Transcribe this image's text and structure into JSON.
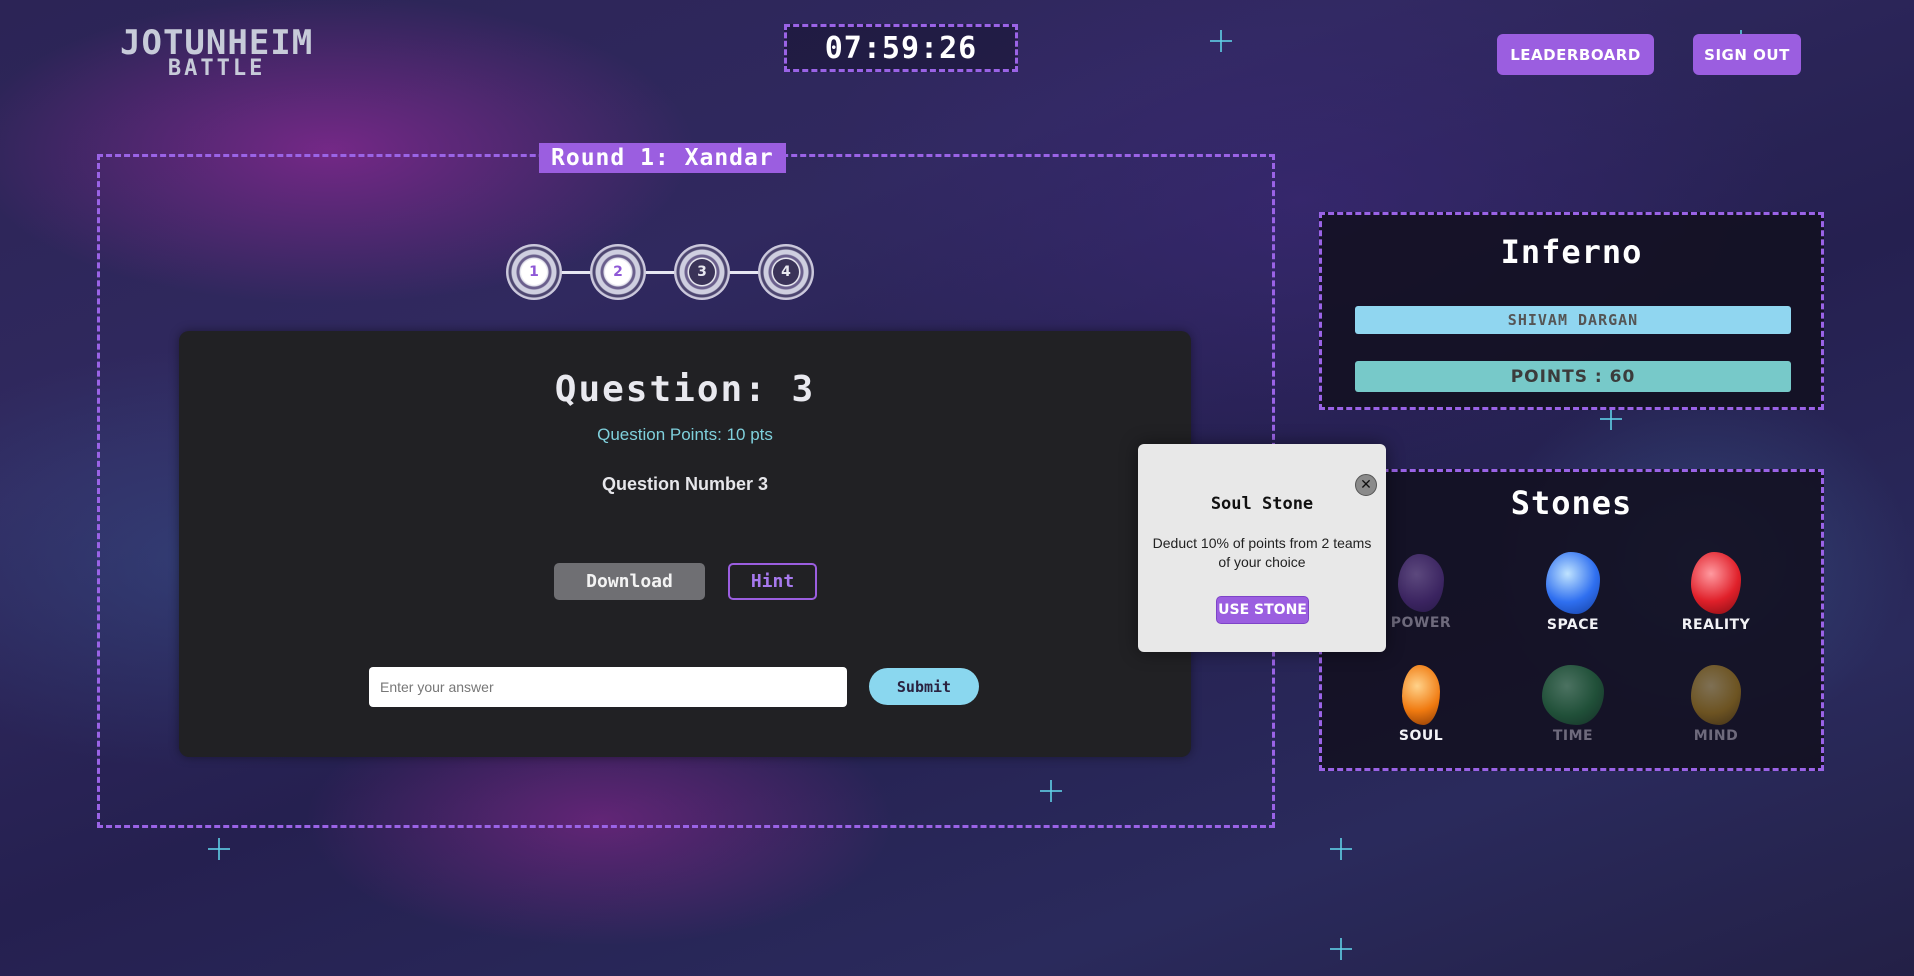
{
  "logo": {
    "line1": "JOTUNHEIM",
    "line2": "BATTLE"
  },
  "timer": "07:59:26",
  "nav": {
    "leaderboard_label": "LEADERBOARD",
    "signout_label": "SIGN OUT"
  },
  "round": {
    "title": "Round 1: Xandar",
    "steps": [
      {
        "label": "1",
        "state": "active"
      },
      {
        "label": "2",
        "state": "active"
      },
      {
        "label": "3",
        "state": "inactive"
      },
      {
        "label": "4",
        "state": "inactive"
      }
    ]
  },
  "question": {
    "title": "Question: 3",
    "points": "Question Points: 10 pts",
    "text": "Question Number 3",
    "download_label": "Download",
    "hint_label": "Hint",
    "answer_placeholder": "Enter your answer",
    "submit_label": "Submit"
  },
  "team": {
    "name": "Inferno",
    "member": "SHIVAM DARGAN",
    "points": "POINTS : 60"
  },
  "stones": {
    "title": "Stones",
    "items": [
      {
        "label": "POWER",
        "state": "dim",
        "color": "#7b4bbd"
      },
      {
        "label": "SPACE",
        "state": "lit",
        "color": "#2f6ff0"
      },
      {
        "label": "REALITY",
        "state": "lit",
        "color": "#e0202a"
      },
      {
        "label": "SOUL",
        "state": "lit",
        "color": "#f07a10"
      },
      {
        "label": "TIME",
        "state": "dim",
        "color": "#2e9a4e"
      },
      {
        "label": "MIND",
        "state": "dim",
        "color": "#d8a21a"
      }
    ]
  },
  "popup": {
    "title": "Soul Stone",
    "description": "Deduct 10% of points from 2 teams of your choice",
    "button_label": "USE STONE",
    "close_glyph": "✕"
  },
  "colors": {
    "accent": "#9b5ee0",
    "cyan": "#8ad7ef",
    "panel": "#212124"
  }
}
